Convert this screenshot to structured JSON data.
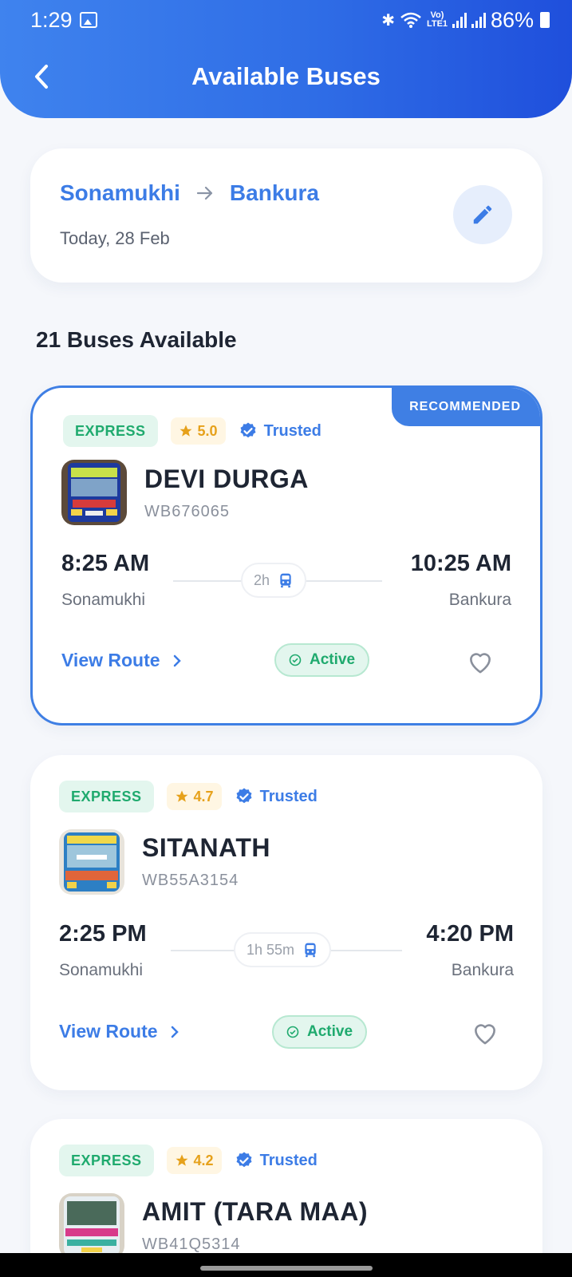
{
  "status_bar": {
    "time": "1:29",
    "lte": "Vo) LTE1",
    "battery": "86%"
  },
  "header": {
    "title": "Available Buses"
  },
  "route": {
    "from": "Sonamukhi",
    "to": "Bankura",
    "date": "Today, 28 Feb"
  },
  "results": {
    "count_label": "21 Buses Available"
  },
  "buses": [
    {
      "recommended_label": "RECOMMENDED",
      "type": "EXPRESS",
      "rating": "5.0",
      "trusted": "Trusted",
      "name": "DEVI DURGA",
      "number": "WB676065",
      "dep_time": "8:25 AM",
      "arr_time": "10:25 AM",
      "from": "Sonamukhi",
      "to": "Bankura",
      "duration": "2h",
      "view_route": "View Route",
      "status": "Active"
    },
    {
      "type": "EXPRESS",
      "rating": "4.7",
      "trusted": "Trusted",
      "name": "SITANATH",
      "number": "WB55A3154",
      "dep_time": "2:25 PM",
      "arr_time": "4:20 PM",
      "from": "Sonamukhi",
      "to": "Bankura",
      "duration": "1h 55m",
      "view_route": "View Route",
      "status": "Active"
    },
    {
      "type": "EXPRESS",
      "rating": "4.2",
      "trusted": "Trusted",
      "name": "AMIT (TARA MAA)",
      "number": "WB41Q5314"
    }
  ],
  "colors": {
    "primary": "#3c7ce6",
    "express": "#1faa6e",
    "rating": "#e6a11b"
  },
  "icons": [
    "back-arrow-icon",
    "edit-pencil-icon",
    "star-icon",
    "verified-badge-icon",
    "bus-icon",
    "chevron-right-icon",
    "check-circle-icon",
    "heart-icon"
  ]
}
